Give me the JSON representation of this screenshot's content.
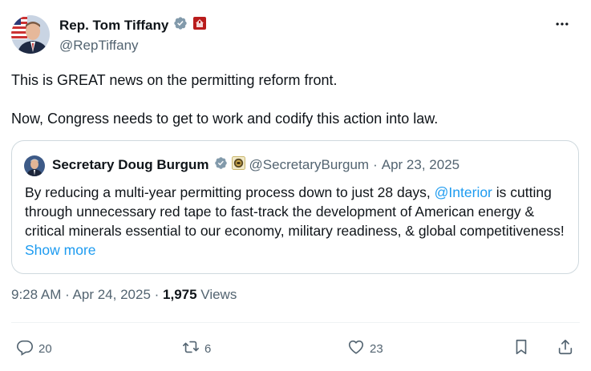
{
  "author": {
    "name": "Rep. Tom Tiffany",
    "handle": "@RepTiffany"
  },
  "tweet": {
    "paragraph1": "This is GREAT news on the permitting reform front.",
    "paragraph2": "Now, Congress needs to get to work and codify this action into law."
  },
  "quote": {
    "name": "Secretary Doug Burgum",
    "handle": "@SecretaryBurgum",
    "separator": "·",
    "date": "Apr 23, 2025",
    "text_before_mention": "By reducing a multi-year permitting process down to just 28 days, ",
    "mention": "@Interior",
    "text_after_mention": " is cutting through unnecessary red tape to fast-track the development of American energy & critical minerals essential to our economy, military readiness, & global competitiveness! ",
    "show_more": "Show more"
  },
  "meta": {
    "time_date": "9:28 AM · Apr 24, 2025 · ",
    "views_count": "1,975",
    "views_label": " Views"
  },
  "actions": {
    "replies": "20",
    "reposts": "6",
    "likes": "23"
  },
  "colors": {
    "accent": "#1d9bf0",
    "secondary_text": "#536471",
    "border": "#cfd9de",
    "verified_gray": "#829aab",
    "house_badge": "#b91c1c"
  },
  "icons": [
    "verified-gray-icon",
    "house-seal-icon",
    "interior-seal-icon",
    "reply-icon",
    "repost-icon",
    "like-icon",
    "bookmark-icon",
    "share-icon",
    "more-icon"
  ]
}
